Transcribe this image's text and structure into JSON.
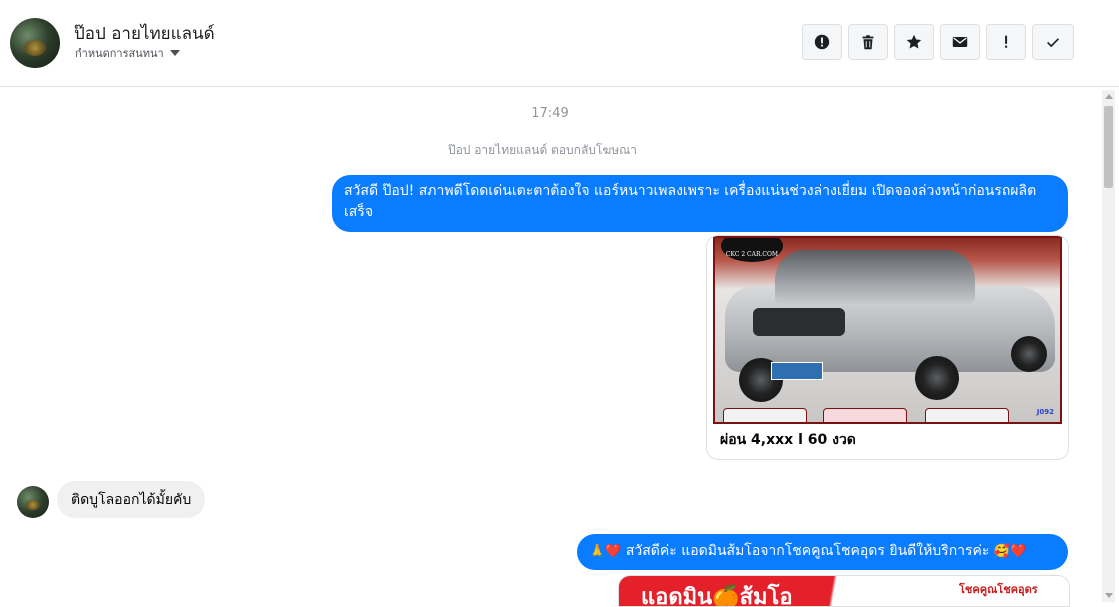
{
  "header": {
    "title": "ป๊อป อายไทยแลนด์",
    "subtitle": "กำหนดการสนทนา",
    "actions": [
      {
        "name": "report-icon",
        "label": "report"
      },
      {
        "name": "trash-icon",
        "label": "delete"
      },
      {
        "name": "star-icon",
        "label": "star"
      },
      {
        "name": "envelope-icon",
        "label": "mark unread"
      },
      {
        "name": "exclamation-icon",
        "label": "spam"
      },
      {
        "name": "checkmark-icon",
        "label": "done"
      }
    ]
  },
  "conversation": {
    "timestamp": "17:49",
    "reply_note": "ป๊อป อายไทยแลนด์ ตอบกลับโฆษณา",
    "messages": [
      {
        "from": "page",
        "text": "สวัสดี ป๊อป! สภาพดีโดดเด่นเตะตาต้องใจ แอร์หนาวเพลงเพราะ เครื่องแน่นช่วงล่างเยี่ยม เปิดจองล่วงหน้าก่อนรถผลิตเสร็จ"
      },
      {
        "from": "page",
        "type": "ad-card",
        "image_watermark": "CKC 2 CAR.COM",
        "image_tag": "J092",
        "caption": "ผ่อน 4,xxx l 60 งวด"
      },
      {
        "from": "user",
        "text": "ติดบูโลออกได้มั้ยคับ"
      },
      {
        "from": "page",
        "prefix_emoji": "🙏❤️",
        "text": "สวัสดีค่ะ แอดมินส้มโอจากโชคคูณโชคอุดร ยินดีให้บริการค่ะ",
        "suffix_emoji": "🥰❤️"
      },
      {
        "from": "page",
        "type": "promo-image",
        "headline": "แอดมิน🍊ส้มโอ",
        "brand": "โชคคูณโชคอุดร"
      }
    ]
  },
  "colors": {
    "outgoing_bubble": "#0a7cff",
    "incoming_bubble": "#f0f0f0"
  }
}
